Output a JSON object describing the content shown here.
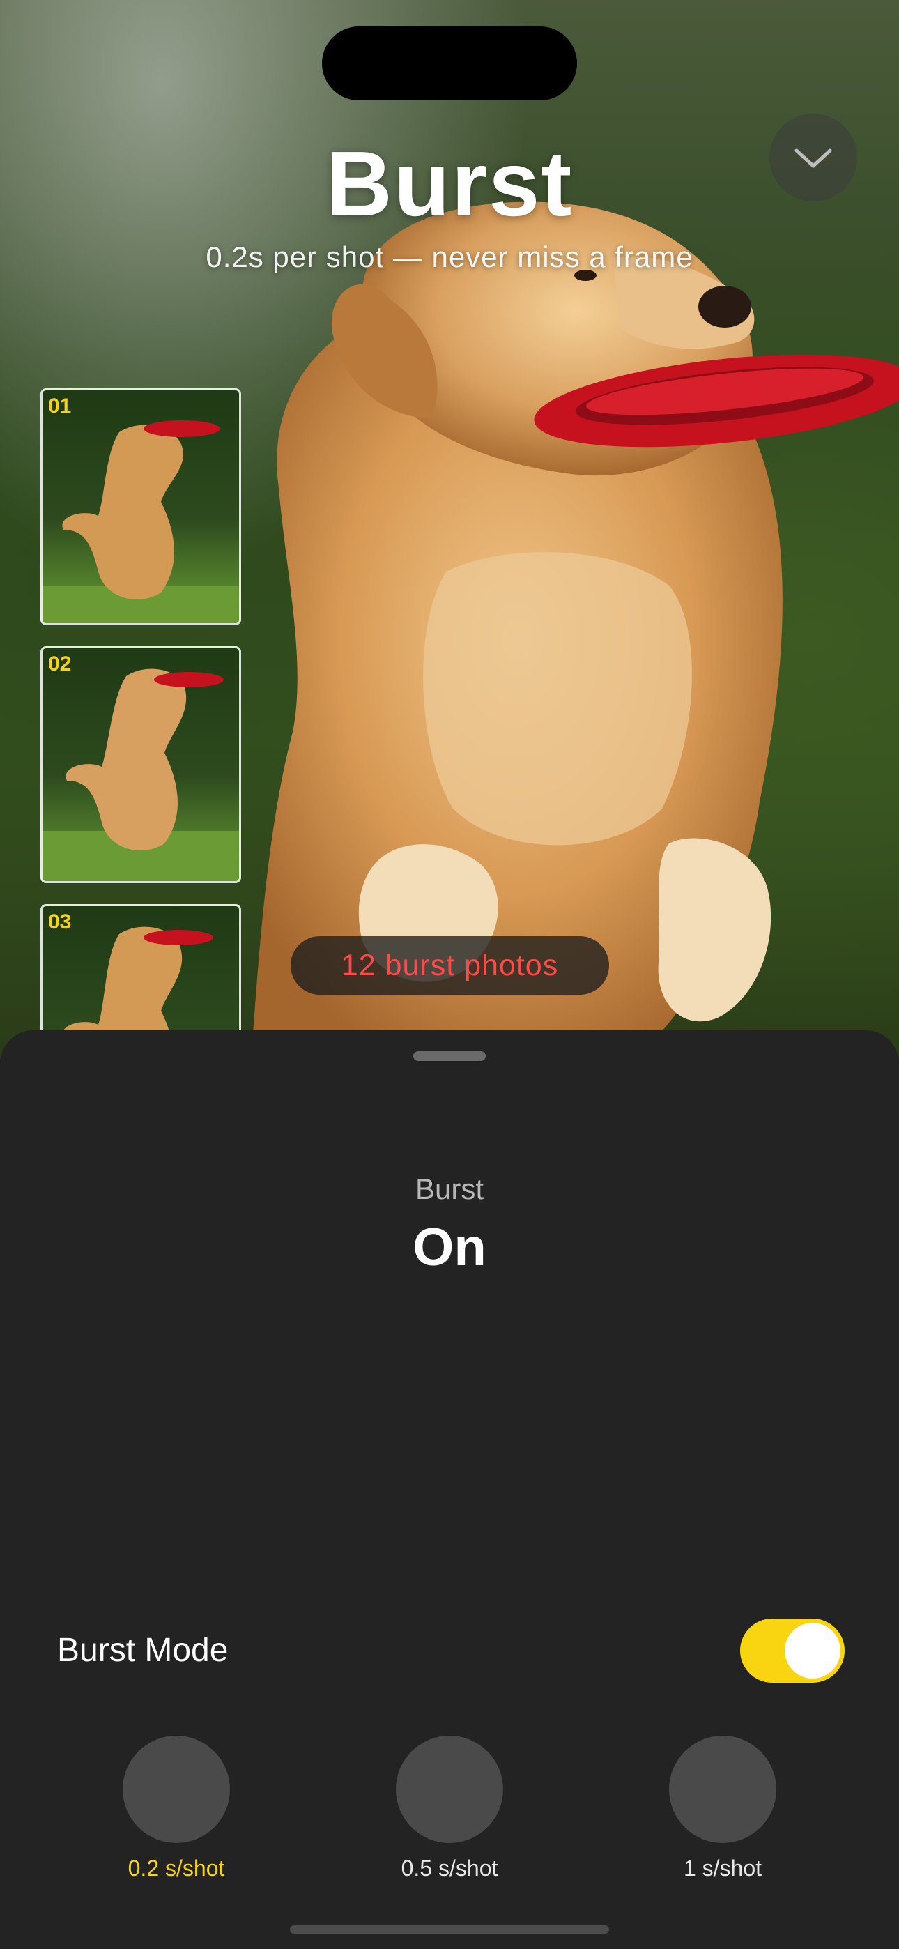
{
  "hero": {
    "title": "Burst",
    "subtitle": "0.2s per shot — never miss a frame",
    "burst_count_label": "12 burst photos",
    "collapse_icon": "chevron-down-icon",
    "thumbnails": [
      {
        "label": "01"
      },
      {
        "label": "02"
      },
      {
        "label": "03"
      }
    ]
  },
  "sheet": {
    "mode_caption": "Burst",
    "mode_value": "On",
    "burst_mode_label": "Burst Mode",
    "burst_mode_enabled": true,
    "speed_options": [
      {
        "label": "0.2 s/shot",
        "selected": true
      },
      {
        "label": "0.5 s/shot",
        "selected": false
      },
      {
        "label": "1 s/shot",
        "selected": false
      }
    ]
  },
  "colors": {
    "accent": "#f8d411",
    "count_text": "#ff4a4a",
    "sheet_bg": "#232323"
  }
}
